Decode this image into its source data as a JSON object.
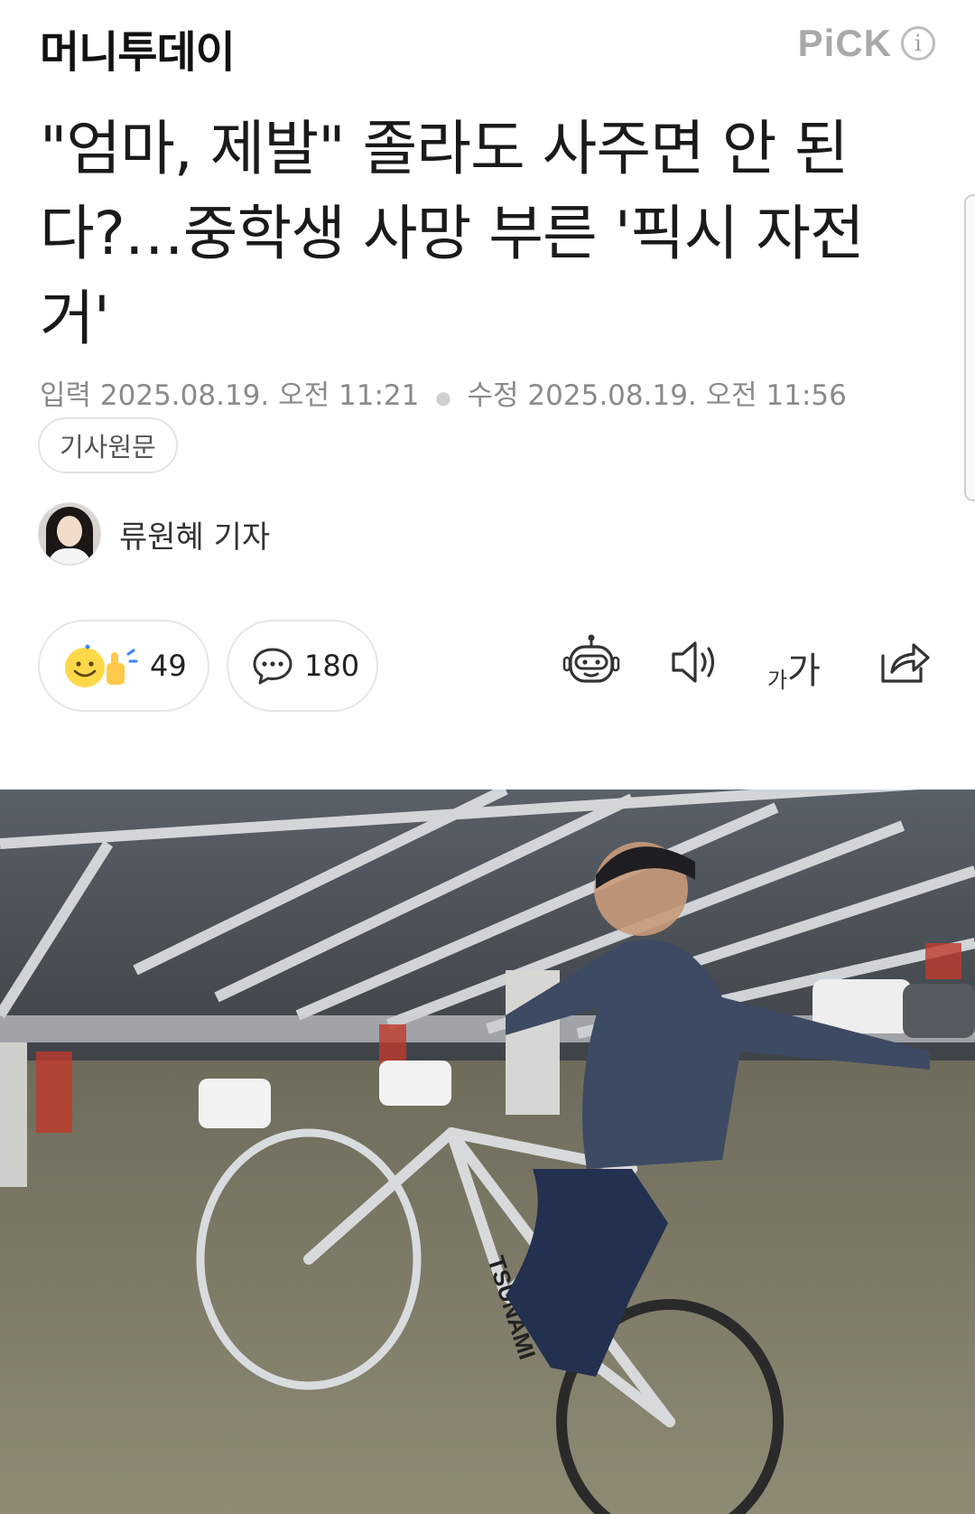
{
  "header": {
    "publisher": "머니투데이",
    "pick_label": "PiCK",
    "info_icon": "info-icon"
  },
  "article": {
    "headline": "\"엄마, 제발\" 졸라도 사주면 안 된다?…중학생 사망 부른 '픽시 자전거'",
    "input_label": "입력",
    "input_datetime": "2025.08.19. 오전 11:21",
    "edit_label": "수정",
    "edit_datetime": "2025.08.19. 오전 11:56",
    "source_button": "기사원문",
    "reporter": "류원혜 기자"
  },
  "actions": {
    "reaction_count": "49",
    "comment_count": "180",
    "icons": [
      "reaction-icon",
      "comment-icon",
      "robot-summary-icon",
      "speaker-icon",
      "font-size-icon",
      "share-icon"
    ],
    "font_size_small": "가",
    "font_size_big": "가"
  },
  "photo": {
    "frame_text": "TSUNAMI"
  },
  "colors": {
    "meta_gray": "#8a8a8a",
    "pick_gray": "#a9a9a9",
    "border": "#e6e6e6"
  }
}
